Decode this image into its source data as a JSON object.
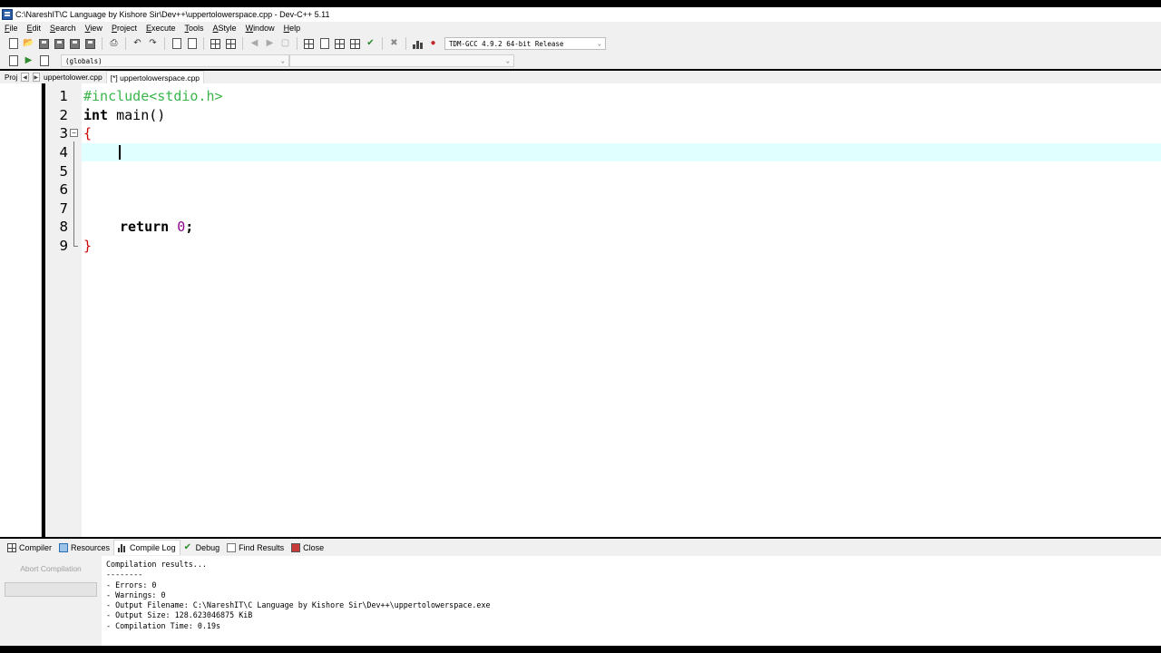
{
  "window": {
    "title": "C:\\NareshIT\\C Language by Kishore Sir\\Dev++\\uppertolowerspace.cpp - Dev-C++ 5.11"
  },
  "menu": [
    {
      "label": "File",
      "ul": "F",
      "rest": "ile"
    },
    {
      "label": "Edit",
      "ul": "E",
      "rest": "dit"
    },
    {
      "label": "Search",
      "ul": "S",
      "rest": "earch"
    },
    {
      "label": "View",
      "ul": "V",
      "rest": "iew"
    },
    {
      "label": "Project",
      "ul": "P",
      "rest": "roject"
    },
    {
      "label": "Execute",
      "ul": "E",
      "rest": "xecute"
    },
    {
      "label": "Tools",
      "ul": "T",
      "rest": "ools"
    },
    {
      "label": "AStyle",
      "ul": "A",
      "rest": "Style"
    },
    {
      "label": "Window",
      "ul": "W",
      "rest": "indow"
    },
    {
      "label": "Help",
      "ul": "H",
      "rest": "elp"
    }
  ],
  "toolbar": {
    "compiler": "TDM-GCC 4.9.2 64-bit Release"
  },
  "toolbar2": {
    "scope": "(globals)",
    "function": ""
  },
  "tabs": {
    "project_panel": "Proj",
    "files": [
      {
        "label": "uppertolower.cpp",
        "active": false
      },
      {
        "label": "[*] uppertolowerspace.cpp",
        "active": true
      }
    ]
  },
  "editor": {
    "current_line": 4,
    "lines": [
      {
        "n": "1",
        "text": "#include<stdio.h>"
      },
      {
        "n": "2",
        "kw": "int",
        "text": " main()"
      },
      {
        "n": "3",
        "text": "{"
      },
      {
        "n": "4",
        "text": ""
      },
      {
        "n": "5",
        "text": ""
      },
      {
        "n": "6",
        "text": ""
      },
      {
        "n": "7",
        "text": ""
      },
      {
        "n": "8",
        "kw": "return",
        "num": "0",
        "tail": ";"
      },
      {
        "n": "9",
        "text": "}"
      }
    ]
  },
  "bottom": {
    "tabs": [
      "Compiler",
      "Resources",
      "Compile Log",
      "Debug",
      "Find Results",
      "Close"
    ],
    "active_tab": "Compile Log",
    "abort_label": "Abort Compilation",
    "progress_percent": 0,
    "log": [
      "Compilation results...",
      "--------",
      "- Errors: 0",
      "- Warnings: 0",
      "- Output Filename: C:\\NareshIT\\C Language by Kishore Sir\\Dev++\\uppertolowerspace.exe",
      "- Output Size: 128.623046875 KiB",
      "- Compilation Time: 0.19s"
    ]
  },
  "colors": {
    "preprocessor": "#39b54a",
    "brace": "#cc0000",
    "number": "#8a008a",
    "current_line_bg": "#e0ffff"
  }
}
